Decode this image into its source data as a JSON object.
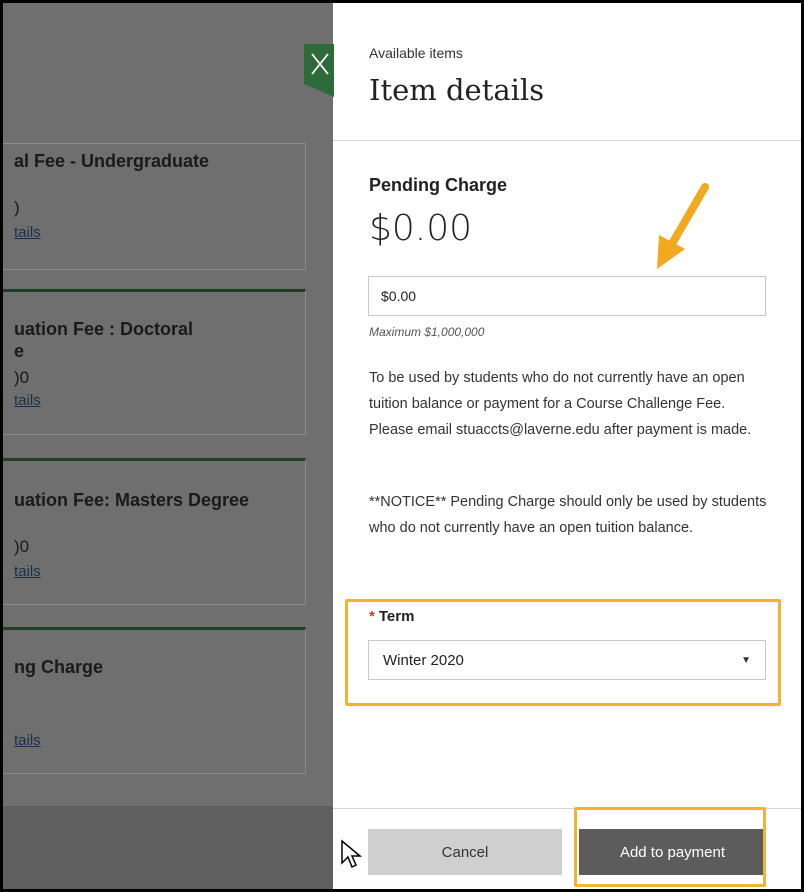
{
  "background_cards": [
    {
      "title": "al Fee - Undergraduate",
      "price": ")",
      "link": "tails"
    },
    {
      "title_lines": [
        "uation Fee : Doctoral",
        "e"
      ],
      "price": ")0",
      "link": "tails"
    },
    {
      "title": "uation Fee: Masters Degree",
      "price": ")0",
      "link": "tails"
    },
    {
      "title": "ng Charge",
      "link": "tails"
    }
  ],
  "panel": {
    "subtitle": "Available items",
    "title": "Item details",
    "close_icon": "close-x-icon",
    "section_title": "Pending Charge",
    "amount": "$0.00",
    "amount_input_value": "$0.00",
    "hint": "Maximum $1,000,000",
    "description": "To be used by students who do not currently have an open tuition balance or payment for a Course Challenge Fee. Please email stuaccts@laverne.edu after payment is made.",
    "notice": "**NOTICE** Pending Charge should only be used by students who do not currently have an open tuition balance.",
    "term_required_mark": "*",
    "term_label": "Term",
    "term_selected": "Winter 2020",
    "cancel_label": "Cancel",
    "add_label": "Add to payment"
  },
  "colors": {
    "close_tab": "#2e6b3a",
    "highlight": "#f2b331",
    "required": "#c0392b"
  }
}
